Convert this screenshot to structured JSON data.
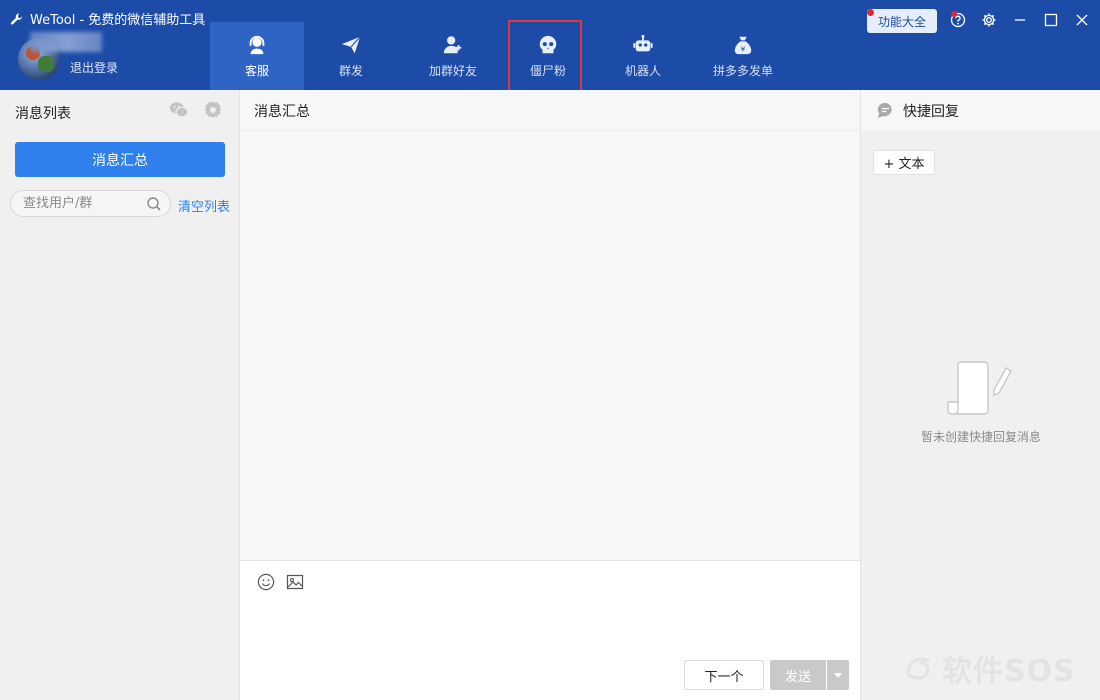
{
  "app": {
    "title": "WeTool - 免费的微信辅助工具",
    "logout": "退出登录",
    "feature_button": "功能大全"
  },
  "nav": [
    {
      "label": "客服",
      "icon": "headset-icon",
      "active": true
    },
    {
      "label": "群发",
      "icon": "paper-plane-icon"
    },
    {
      "label": "加群好友",
      "icon": "add-user-icon"
    },
    {
      "label": "僵尸粉",
      "icon": "skull-icon",
      "highlighted": true
    },
    {
      "label": "机器人",
      "icon": "robot-icon"
    },
    {
      "label": "拼多多发单",
      "icon": "money-bag-icon"
    }
  ],
  "left": {
    "title": "消息列表",
    "summary_button": "消息汇总",
    "search_placeholder": "查找用户/群",
    "clear_link": "清空列表"
  },
  "center": {
    "title": "消息汇总",
    "next_button": "下一个",
    "send_button": "发送"
  },
  "right": {
    "title": "快捷回复",
    "add_text_button": "+ 文本",
    "empty_text": "暂未创建快捷回复消息"
  },
  "watermark": "软件SOS",
  "colors": {
    "header": "#1d4ba8",
    "nav_active": "#2f64c4",
    "primary": "#2f80ed",
    "highlight_border": "#e0383e"
  }
}
